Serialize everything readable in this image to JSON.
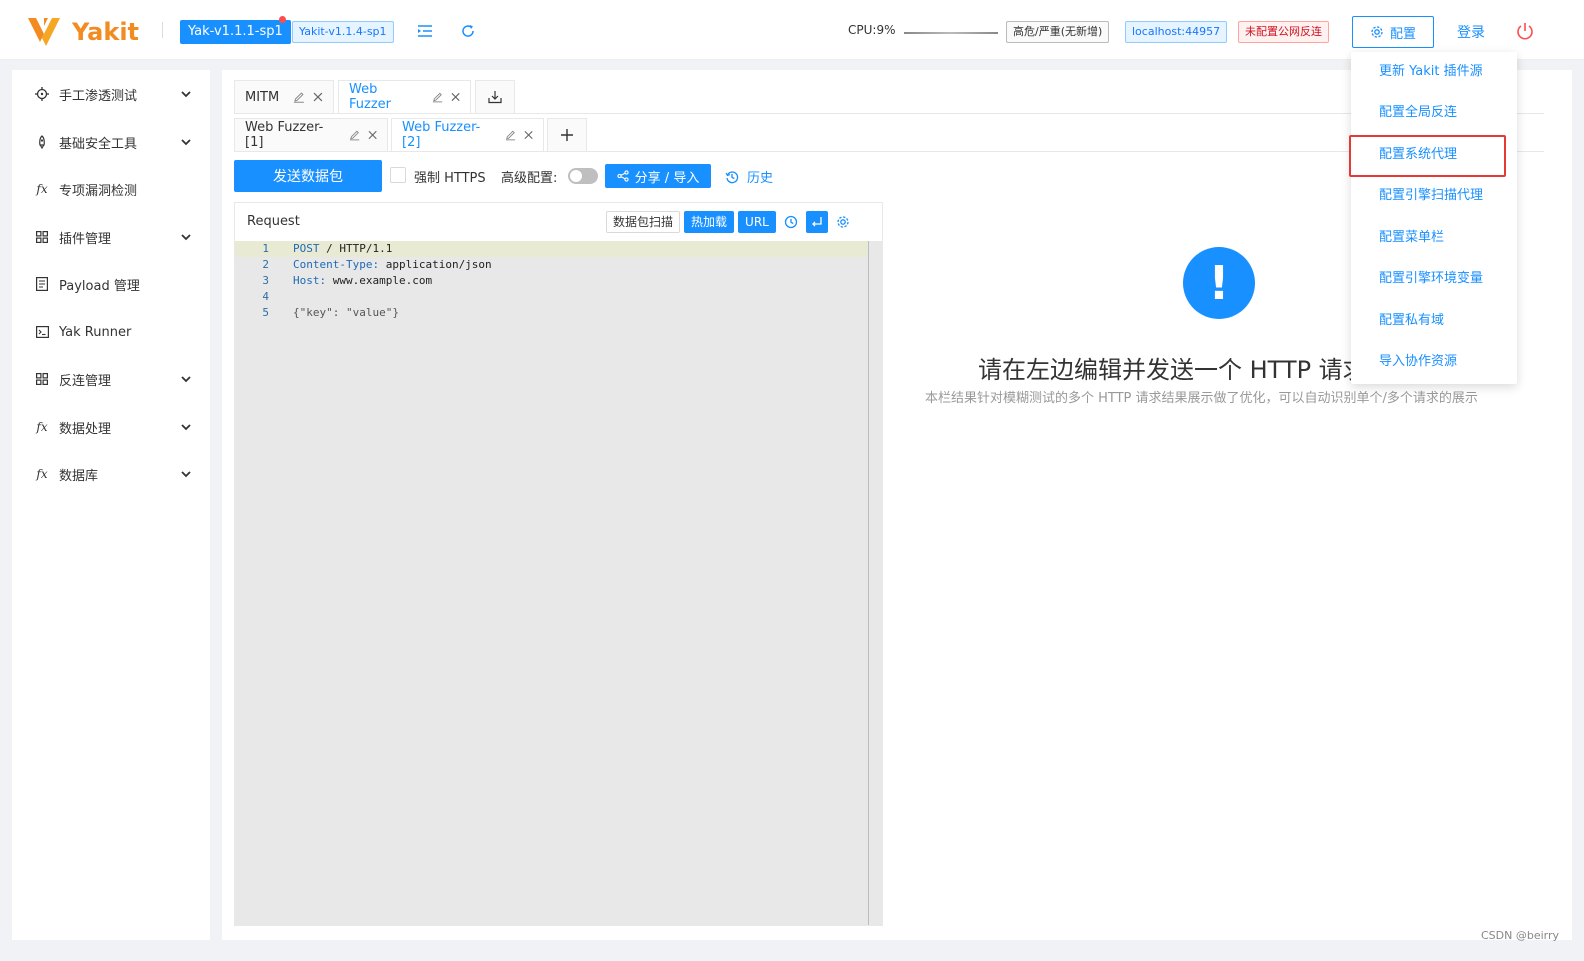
{
  "header": {
    "logo_text": "Yakit",
    "version_main": "Yak-v1.1.1-sp1",
    "version_sub": "Yakit-v1.1.4-sp1",
    "cpu_label": "CPU:9%",
    "risk_tag": "高危/严重(无新增)",
    "host_tag": "localhost:44957",
    "reverse_tag": "未配置公网反连",
    "config_label": "配置",
    "login_label": "登录"
  },
  "sidebar": {
    "items": [
      {
        "label": "手工渗透测试",
        "icon": "crosshair-icon",
        "has_submenu": true
      },
      {
        "label": "基础安全工具",
        "icon": "rocket-icon",
        "has_submenu": true
      },
      {
        "label": "专项漏洞检测",
        "icon": "fx-icon",
        "has_submenu": false
      },
      {
        "label": "插件管理",
        "icon": "grid-icon",
        "has_submenu": true
      },
      {
        "label": "Payload 管理",
        "icon": "doc-icon",
        "has_submenu": false
      },
      {
        "label": "Yak Runner",
        "icon": "terminal-icon",
        "has_submenu": false
      },
      {
        "label": "反连管理",
        "icon": "grid-icon",
        "has_submenu": true
      },
      {
        "label": "数据处理",
        "icon": "fx-icon",
        "has_submenu": true
      },
      {
        "label": "数据库",
        "icon": "fx-icon",
        "has_submenu": true
      }
    ]
  },
  "tabs": {
    "main": [
      {
        "label": "MITM",
        "active": false
      },
      {
        "label": "Web Fuzzer",
        "active": true
      }
    ],
    "sub": [
      {
        "label": "Web Fuzzer-[1]",
        "active": false
      },
      {
        "label": "Web Fuzzer-[2]",
        "active": true
      }
    ]
  },
  "toolbar": {
    "send_label": "发送数据包",
    "force_https_label": "强制 HTTPS",
    "force_https_checked": false,
    "advanced_label": "高级配置:",
    "advanced_enabled": false,
    "share_label": "分享 / 导入",
    "history_label": "历史"
  },
  "request": {
    "title": "Request",
    "scan_label": "数据包扫描",
    "hotload_label": "热加载",
    "url_label": "URL",
    "lines": [
      {
        "n": "1",
        "key": "POST",
        "rest": " / HTTP/1.1"
      },
      {
        "n": "2",
        "key": "Content-Type:",
        "rest": " application/json"
      },
      {
        "n": "3",
        "key": "Host:",
        "rest": " www.example.com"
      },
      {
        "n": "4",
        "key": "",
        "rest": ""
      },
      {
        "n": "5",
        "key": "",
        "rest": "{\"key\": \"value\"}"
      }
    ]
  },
  "empty": {
    "icon_glyph": "!",
    "title": "请在左边编辑并发送一个 HTTP 请求/模糊测试",
    "subtitle": "本栏结果针对模糊测试的多个 HTTP 请求结果展示做了优化，可以自动识别单个/多个请求的展示"
  },
  "dropdown": {
    "items": [
      "更新 Yakit 插件源",
      "配置全局反连",
      "配置系统代理",
      "配置引擎扫描代理",
      "配置菜单栏",
      "配置引擎环境变量",
      "配置私有域",
      "导入协作资源"
    ],
    "highlighted_index": 2
  },
  "watermark": "CSDN @beirry",
  "colors": {
    "accent": "#1890ff",
    "brand": "#f28b20",
    "danger": "#e53935"
  }
}
